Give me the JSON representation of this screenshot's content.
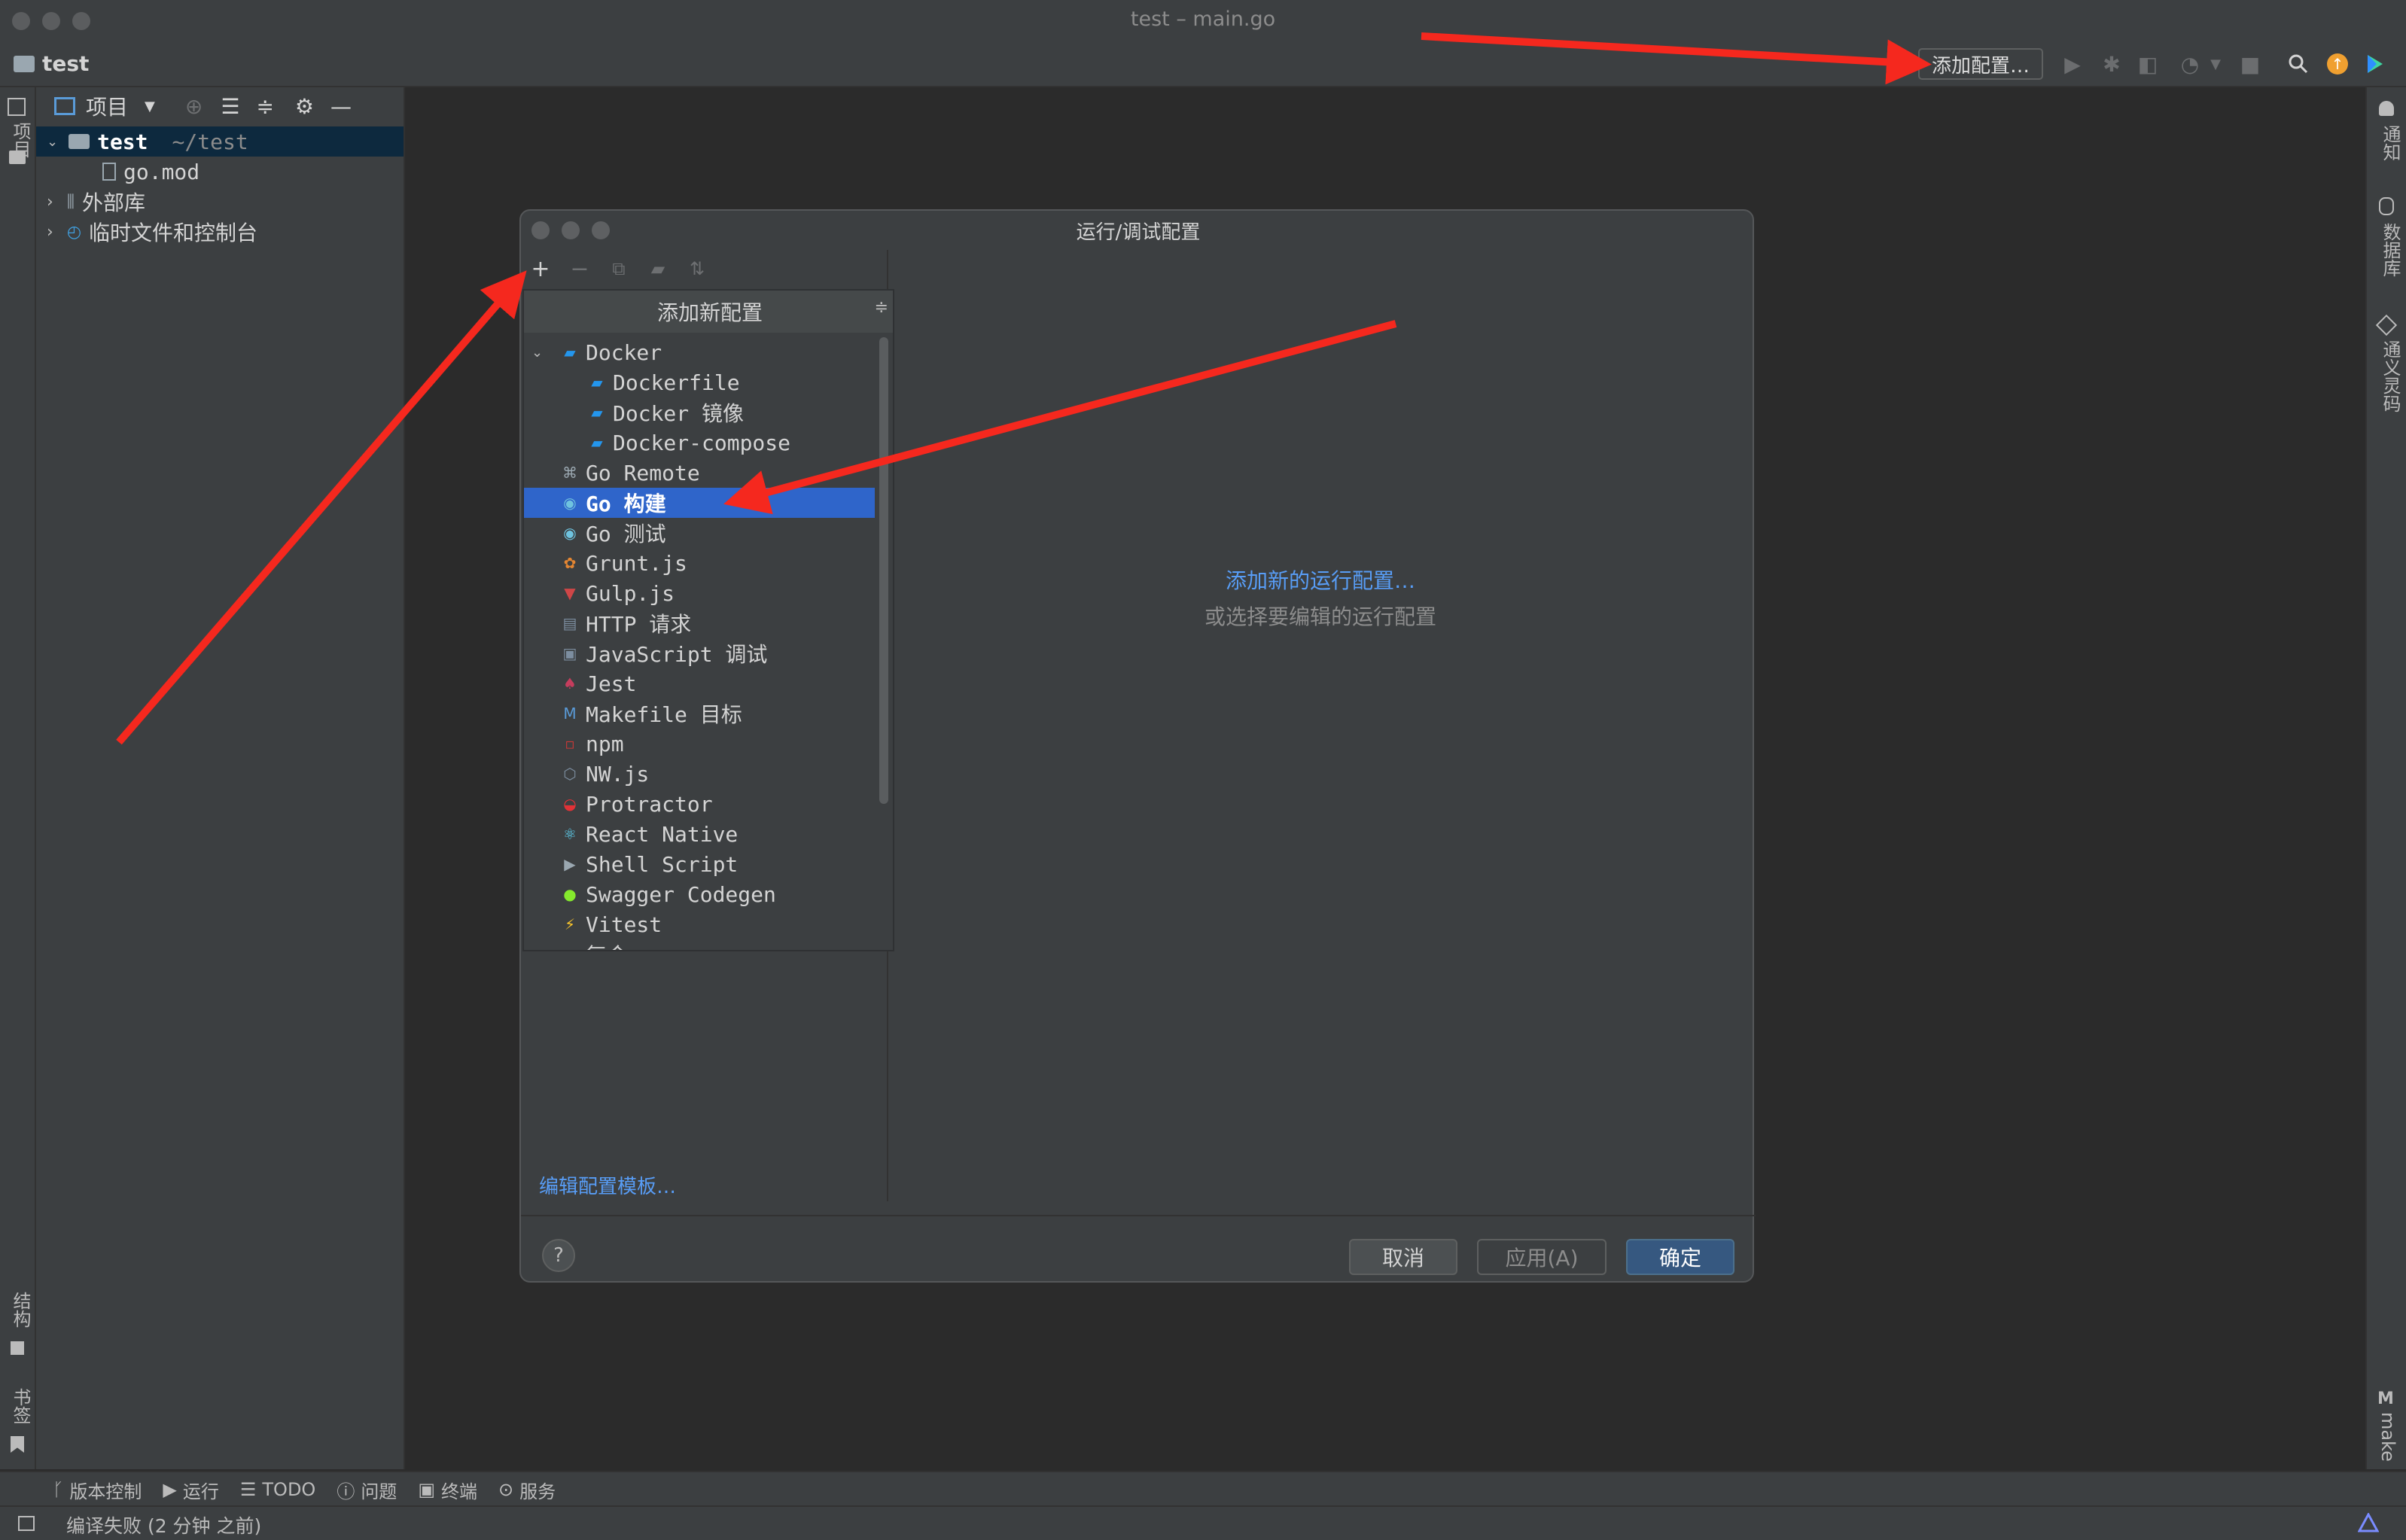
{
  "window": {
    "title": "test – main.go"
  },
  "navbar": {
    "project": "test",
    "add_config_button": "添加配置…"
  },
  "left_strip": {
    "top_label": "项目",
    "structure_label": "结构",
    "bookmarks_label": "书签"
  },
  "project_panel": {
    "header_label": "项目",
    "tree": {
      "root_name": "test",
      "root_path": "~/test",
      "file_gomod": "go.mod",
      "external_libs": "外部库",
      "scratches": "临时文件和控制台"
    }
  },
  "right_strip": {
    "notifications": "通知",
    "database": "数据库",
    "tongyi": "通义灵码",
    "make": "make"
  },
  "dialog": {
    "title": "运行/调试配置",
    "edit_templates": "编辑配置模板…",
    "center_link": "添加新的运行配置…",
    "center_hint": "或选择要编辑的运行配置",
    "cancel": "取消",
    "apply": "应用(A)",
    "ok": "确定",
    "help": "?"
  },
  "popup": {
    "header": "添加新配置",
    "items": [
      {
        "label": "Docker",
        "icon": "docker-icon"
      },
      {
        "label": "Dockerfile",
        "icon": "docker-icon"
      },
      {
        "label": "Docker 镜像",
        "icon": "docker-icon"
      },
      {
        "label": "Docker-compose",
        "icon": "docker-icon"
      },
      {
        "label": "Go Remote",
        "icon": "go-remote-icon"
      },
      {
        "label": "Go 构建",
        "icon": "go-icon"
      },
      {
        "label": "Go 测试",
        "icon": "go-icon"
      },
      {
        "label": "Grunt.js",
        "icon": "grunt-icon"
      },
      {
        "label": "Gulp.js",
        "icon": "gulp-icon"
      },
      {
        "label": "HTTP 请求",
        "icon": "http-api-icon"
      },
      {
        "label": "JavaScript 调试",
        "icon": "js-debug-icon"
      },
      {
        "label": "Jest",
        "icon": "jest-icon"
      },
      {
        "label": "Makefile 目标",
        "icon": "makefile-icon"
      },
      {
        "label": "npm",
        "icon": "npm-icon"
      },
      {
        "label": "NW.js",
        "icon": "nwjs-icon"
      },
      {
        "label": "Protractor",
        "icon": "protractor-icon"
      },
      {
        "label": "React Native",
        "icon": "react-icon"
      },
      {
        "label": "Shell Script",
        "icon": "shell-icon"
      },
      {
        "label": "Swagger Codegen",
        "icon": "swagger-icon"
      },
      {
        "label": "Vitest",
        "icon": "vitest-icon"
      },
      {
        "label": "复合",
        "icon": "folder-icon"
      }
    ],
    "selected": "Go 构建"
  },
  "bottom_toolbar": {
    "vcs": "版本控制",
    "run": "运行",
    "todo": "TODO",
    "problems": "问题",
    "terminal": "终端",
    "services": "服务"
  },
  "status": {
    "message": "编译失败 (2 分钟 之前)"
  },
  "colors": {
    "selection": "#2f65ca",
    "link": "#589df6",
    "annotation_arrow": "#f5281e",
    "primary_button": "#365880"
  }
}
